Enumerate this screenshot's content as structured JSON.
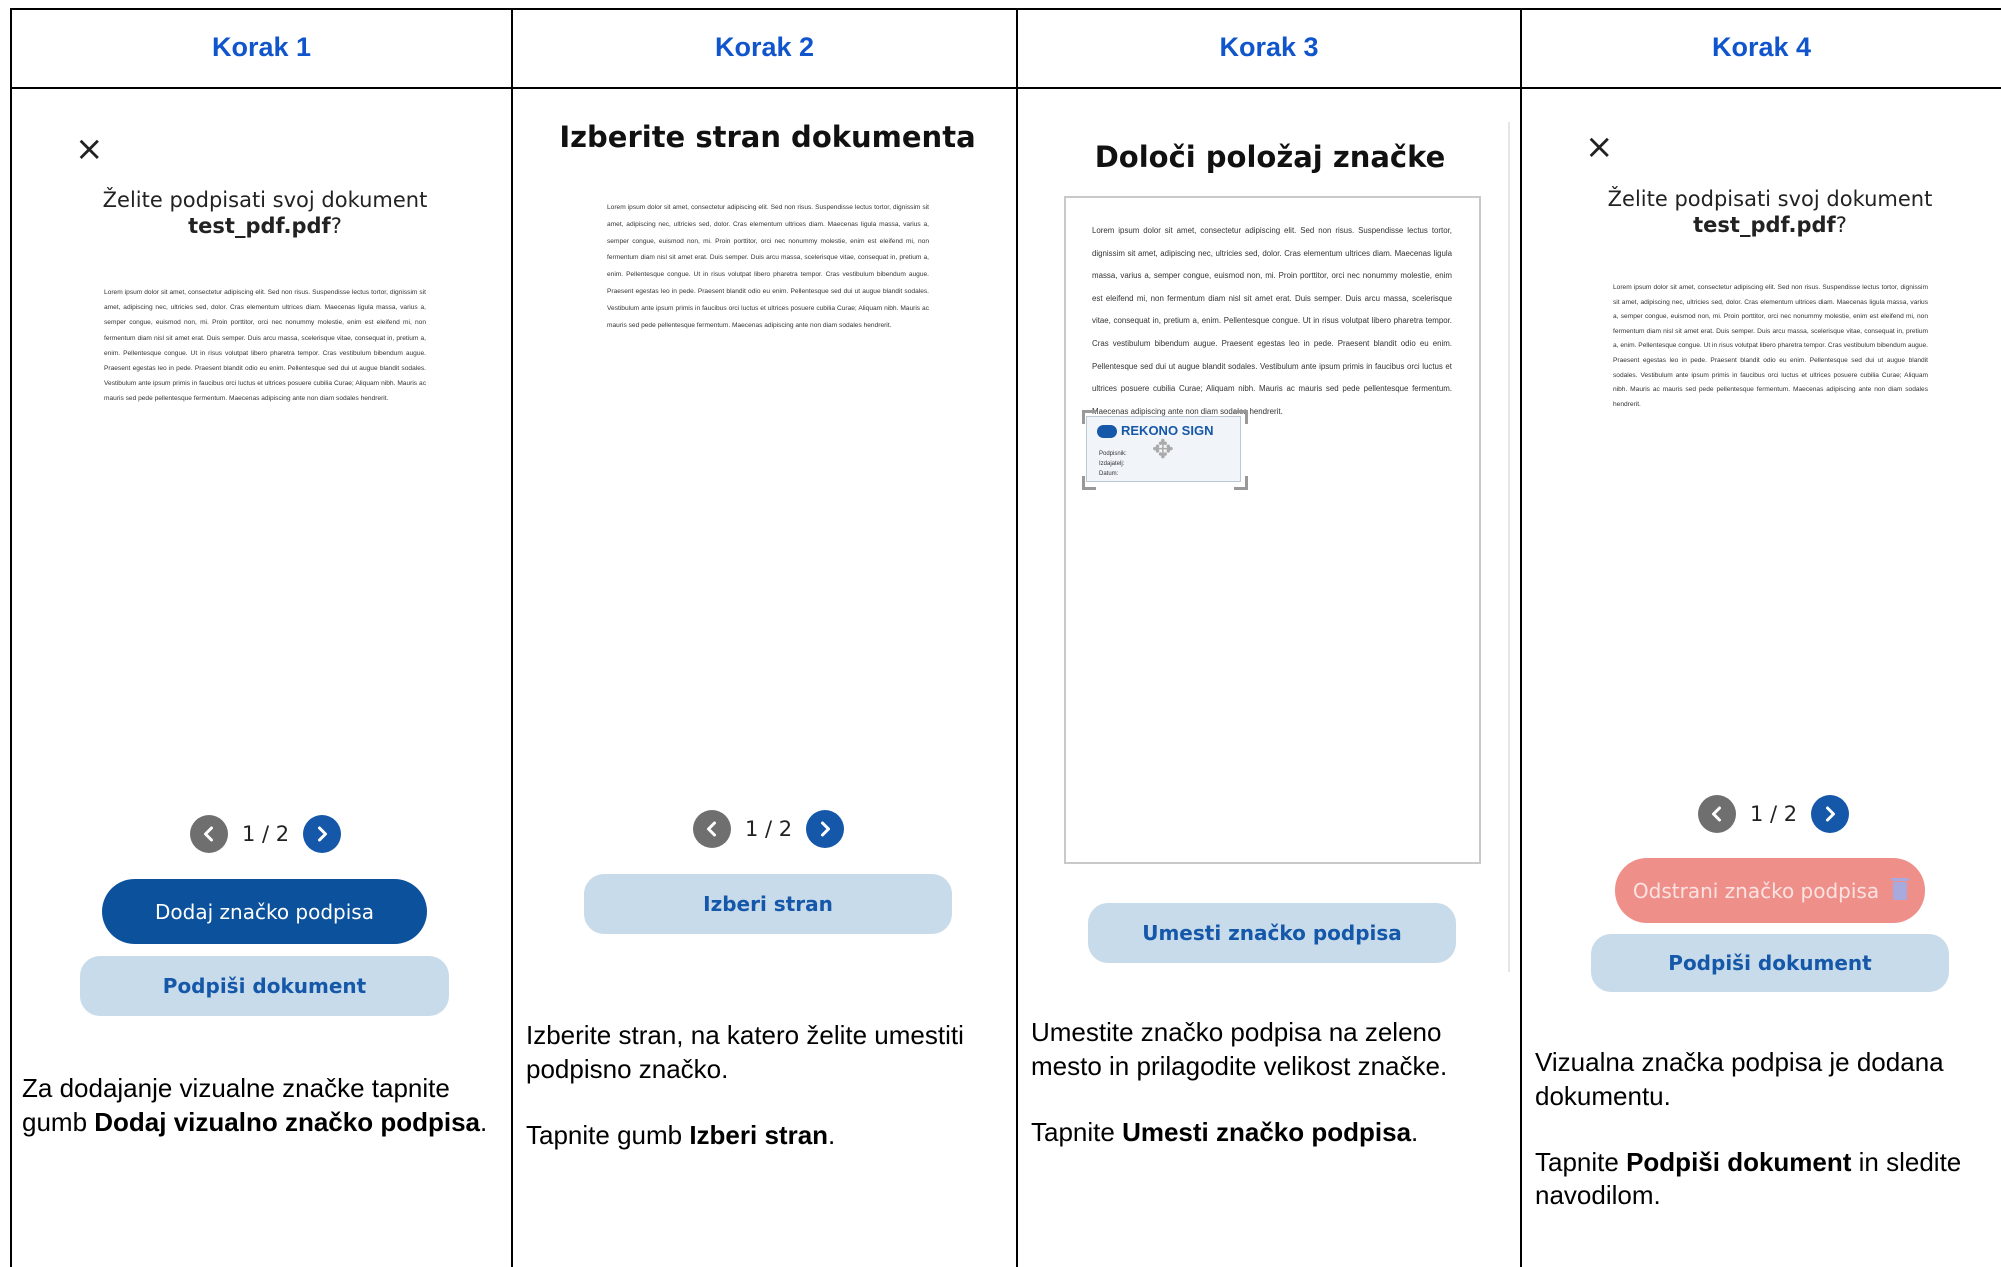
{
  "steps": [
    {
      "header": "Korak 1",
      "close_icon": "×",
      "question_line1": "Želite podpisati svoj dokument",
      "filename": "test_pdf.pdf",
      "question_suffix": "?",
      "doc_text": "Lorem ipsum dolor sit amet, consectetur adipiscing elit. Sed non risus. Suspendisse lectus tortor, dignissim sit amet, adipiscing nec, ultricies sed, dolor. Cras elementum ultrices diam. Maecenas ligula massa, varius a, semper congue, euismod non, mi. Proin porttitor, orci nec nonummy molestie, enim est eleifend mi, non fermentum diam nisl sit amet erat. Duis semper. Duis arcu massa, scelerisque vitae, consequat in, pretium a, enim. Pellentesque congue. Ut in risus volutpat libero pharetra tempor. Cras vestibulum bibendum augue. Praesent egestas leo in pede. Praesent blandit odio eu enim. Pellentesque sed dui ut augue blandit sodales. Vestibulum ante ipsum primis in faucibus orci luctus et ultrices posuere cubilia Curae; Aliquam nibh. Mauris ac mauris sed pede pellentesque fermentum. Maecenas adipiscing ante non diam sodales hendrerit.",
      "page_indicator": "1 / 2",
      "primary_button": "Dodaj značko podpisa",
      "secondary_button": "Podpiši dokument",
      "desc_pre": "Za dodajanje vizualne značke tapnite gumb ",
      "desc_bold": "Dodaj vizualno značko podpisa",
      "desc_post": "."
    },
    {
      "header": "Korak 2",
      "title": "Izberite stran dokumenta",
      "doc_text": "Lorem ipsum dolor sit amet, consectetur adipiscing elit. Sed non risus. Suspendisse lectus tortor, dignissim sit amet, adipiscing nec, ultricies sed, dolor. Cras elementum ultrices diam. Maecenas ligula massa, varius a, semper congue, euismod non, mi. Proin porttitor, orci nec nonummy molestie, enim est eleifend mi, non fermentum diam nisl sit amet erat. Duis semper. Duis arcu massa, scelerisque vitae, consequat in, pretium a, enim. Pellentesque congue. Ut in risus volutpat libero pharetra tempor. Cras vestibulum bibendum augue. Praesent egestas leo in pede. Praesent blandit odio eu enim. Pellentesque sed dui ut augue blandit sodales. Vestibulum ante ipsum primis in faucibus orci luctus et ultrices posuere cubilia Curae; Aliquam nibh. Mauris ac mauris sed pede pellentesque fermentum. Maecenas adipiscing ante non diam sodales hendrerit.",
      "page_indicator": "1 / 2",
      "button": "Izberi stran",
      "desc1": "Izberite stran, na katero želite umestiti podpisno značko.",
      "desc2_pre": "Tapnite gumb ",
      "desc2_bold": "Izberi stran",
      "desc2_post": "."
    },
    {
      "header": "Korak 3",
      "title": "Določi položaj značke",
      "doc_text": "Lorem ipsum dolor sit amet, consectetur adipiscing elit. Sed non risus. Suspendisse lectus tortor, dignissim sit amet, adipiscing nec, ultricies sed, dolor. Cras elementum ultrices diam. Maecenas ligula massa, varius a, semper congue, euismod non, mi. Proin porttitor, orci nec nonummy molestie, enim est eleifend mi, non fermentum diam nisl sit amet erat. Duis semper. Duis arcu massa, scelerisque vitae, consequat in, pretium a, enim. Pellentesque congue. Ut in risus volutpat libero pharetra tempor. Cras vestibulum bibendum augue. Praesent egestas leo in pede. Praesent blandit odio eu enim. Pellentesque sed dui ut augue blandit sodales. Vestibulum ante ipsum primis in faucibus orci luctus et ultrices posuere cubilia Curae; Aliquam nibh. Mauris ac mauris sed pede pellentesque fermentum. Maecenas adipiscing ante non diam sodales hendrerit.",
      "badge_logo": "REKONO SIGN",
      "badge_fields": [
        "Podpisnik:",
        "Izdajatelj:",
        "Datum:"
      ],
      "button": "Umesti značko podpisa",
      "desc1": "Umestite značko podpisa na zeleno mesto in prilagodite velikost značke.",
      "desc2_pre": "Tapnite ",
      "desc2_bold": "Umesti značko podpisa",
      "desc2_post": "."
    },
    {
      "header": "Korak 4",
      "close_icon": "×",
      "question_line1": "Želite podpisati svoj dokument",
      "filename": "test_pdf.pdf",
      "question_suffix": "?",
      "doc_text": "Lorem ipsum dolor sit amet, consectetur adipiscing elit. Sed non risus. Suspendisse lectus tortor, dignissim sit amet, adipiscing nec, ultricies sed, dolor. Cras elementum ultrices diam. Maecenas ligula massa, varius a, semper congue, euismod non, mi. Proin porttitor, orci nec nonummy molestie, enim est eleifend mi, non fermentum diam nisl sit amet erat. Duis semper. Duis arcu massa, scelerisque vitae, consequat in, pretium a, enim. Pellentesque congue. Ut in risus volutpat libero pharetra tempor. Cras vestibulum bibendum augue. Praesent egestas leo in pede. Praesent blandit odio eu enim. Pellentesque sed dui ut augue blandit sodales. Vestibulum ante ipsum primis in faucibus orci luctus et ultrices posuere cubilia Curae; Aliquam nibh. Mauris ac mauris sed pede pellentesque fermentum. Maecenas adipiscing ante non diam sodales hendrerit.",
      "page_indicator": "1 / 2",
      "danger_button": "Odstrani značko podpisa",
      "secondary_button": "Podpiši dokument",
      "desc1": "Vizualna značka podpisa je dodana dokumentu.",
      "desc2_pre": "Tapnite ",
      "desc2_bold": "Podpiši dokument",
      "desc2_post": " in sledite navodilom."
    }
  ],
  "colors": {
    "header_text": "#1155cc",
    "primary_button": "#0c519c",
    "secondary_button": "#c8dbeb",
    "danger_button": "#ef8f8a",
    "pager_prev": "#6f6f6f",
    "pager_next": "#1557a8"
  },
  "icons": {
    "close": "close-icon",
    "prev": "chevron-left-icon",
    "next": "chevron-right-icon",
    "trash": "trash-icon",
    "move": "move-icon"
  }
}
